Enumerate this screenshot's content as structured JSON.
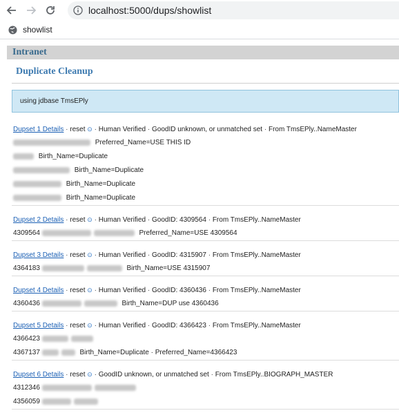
{
  "browser": {
    "url": "localhost:5000/dups/showlist",
    "bookmark_label": "showlist"
  },
  "page": {
    "site_title": "Intranet",
    "title": "Duplicate Cleanup",
    "info": "using jdbase TmsEPly"
  },
  "dupsets": [
    {
      "link": "Dupset 1 Details",
      "reset": "reset",
      "verification": "Human Verified",
      "goodid": "GoodID unknown, or unmatched set",
      "source": "From TmsEPly..NameMaster",
      "rows": [
        {
          "id": "",
          "note": "Preferred_Name=USE THIS ID"
        },
        {
          "id": "",
          "note": "Birth_Name=Duplicate"
        },
        {
          "id": "",
          "note": "Birth_Name=Duplicate"
        },
        {
          "id": "",
          "note": "Birth_Name=Duplicate"
        },
        {
          "id": "",
          "note": "Birth_Name=Duplicate"
        }
      ]
    },
    {
      "link": "Dupset 2 Details",
      "reset": "reset",
      "verification": "Human Verified",
      "goodid": "GoodID: 4309564",
      "source": "From TmsEPly..NameMaster",
      "rows": [
        {
          "id": "4309564",
          "note": "Preferred_Name=USE 4309564"
        }
      ]
    },
    {
      "link": "Dupset 3 Details",
      "reset": "reset",
      "verification": "Human Verified",
      "goodid": "GoodID: 4315907",
      "source": "From TmsEPly..NameMaster",
      "rows": [
        {
          "id": "4364183",
          "note": "Birth_Name=USE 4315907"
        }
      ]
    },
    {
      "link": "Dupset 4 Details",
      "reset": "reset",
      "verification": "Human Verified",
      "goodid": "GoodID: 4360436",
      "source": "From TmsEPly..NameMaster",
      "rows": [
        {
          "id": "4360436",
          "note": "Birth_Name=DUP use 4360436"
        }
      ]
    },
    {
      "link": "Dupset 5 Details",
      "reset": "reset",
      "verification": "Human Verified",
      "goodid": "GoodID: 4366423",
      "source": "From TmsEPly..NameMaster",
      "rows": [
        {
          "id": "4366423",
          "note": ""
        },
        {
          "id": "4367137",
          "note": "Birth_Name=Duplicate · Preferred_Name=4366423"
        }
      ]
    },
    {
      "link": "Dupset 6 Details",
      "reset": "reset",
      "verification": "",
      "goodid": "GoodID unknown, or unmatched set",
      "source": "From TmsEPly..BIOGRAPH_MASTER",
      "rows": [
        {
          "id": "4312346",
          "note": ""
        },
        {
          "id": "4356059",
          "note": ""
        }
      ]
    }
  ]
}
